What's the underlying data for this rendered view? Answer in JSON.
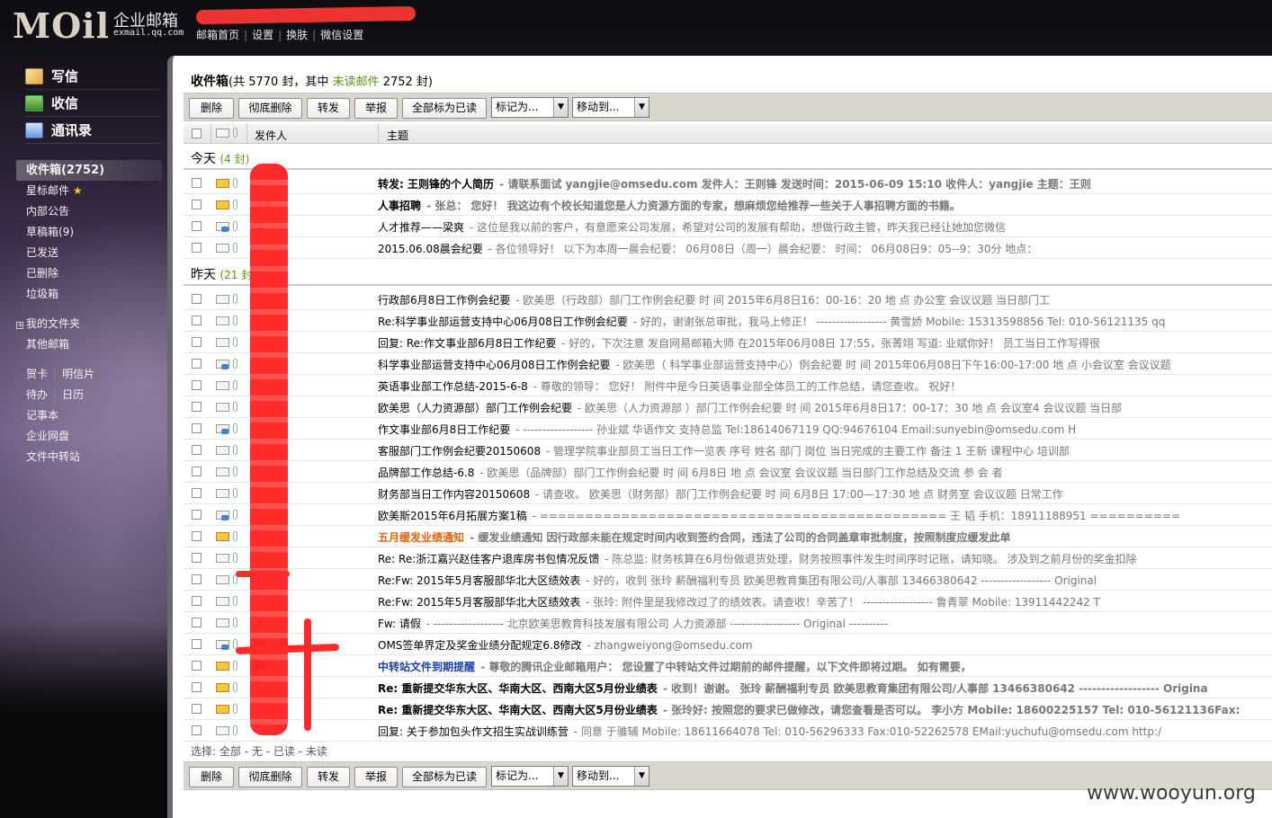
{
  "header": {
    "logo": "MOil",
    "product": "企业邮箱",
    "domain": "exmail.qq.com",
    "topnav": [
      "邮箱首页",
      "设置",
      "换肤",
      "微信设置"
    ]
  },
  "leftnav": {
    "big": [
      "写信",
      "收信",
      "通讯录"
    ],
    "folders": [
      "收件箱(2752)",
      "星标邮件",
      "内部公告",
      "草稿箱(9)",
      "已发送",
      "已删除",
      "垃圾箱"
    ],
    "star_icon": "★",
    "myfolders": "我的文件夹",
    "other": "其他邮箱",
    "tools": [
      [
        "贺卡",
        "明信片"
      ],
      [
        "待办",
        "日历"
      ]
    ],
    "tools2": [
      "记事本",
      "企业网盘",
      "文件中转站"
    ]
  },
  "folder": {
    "name": "收件箱",
    "total_pre": "(共 5770 封，其中",
    "unread_label": "未读邮件",
    "unread_post": "2752 封)"
  },
  "toolbar": {
    "delete": "删除",
    "perm_delete": "彻底删除",
    "forward": "转发",
    "report": "举报",
    "mark_all_read": "全部标为已读",
    "mark_as": "标记为...",
    "move_to": "移动到...",
    "arrow": "▼"
  },
  "columns": {
    "sender": "发件人",
    "subject": "主题"
  },
  "groups": {
    "today": {
      "label": "今天",
      "count": "(4 封)"
    },
    "yesterday": {
      "label": "昨天",
      "count": "(21 封)"
    }
  },
  "emails_today": [
    {
      "sender": "",
      "subject": "转发: 王则锋的个人简历",
      "snippet": " - 请联系面试 yangjie@omsedu.com 发件人：王则锋 发送时间：2015-06-09 15:10 收件人：yangjie 主题：王则",
      "style": "bold",
      "env": "unread"
    },
    {
      "sender": "y        a",
      "subject": "人事招聘",
      "snippet": " - 张总：  您好！  我这边有个校长知道您是人力资源方面的专家，想麻烦您给推荐一些关于人事招聘方面的书籍。",
      "style": "bold",
      "env": "unread"
    },
    {
      "sender": "李",
      "subject": "人才推荐——梁爽",
      "snippet": " - 这位是我以前的客户，有意愿来公司发展，希望对公司的发展有帮助，想做行政主管，昨天我已经让她加您微信",
      "style": "",
      "env": "replied"
    },
    {
      "sender": "",
      "subject": "2015.06.08晨会纪要",
      "snippet": " - 各位领导好！  以下为本周一晨会纪要：  06月08日（周一）晨会纪要：  时间：  06月08日9：05--9：30分 地点：",
      "style": "",
      "env": "read"
    }
  ],
  "emails_yesterday": [
    {
      "sender": "",
      "subject": "行政部6月8日工作例会纪要",
      "snippet": " - 欧美思（行政部）部门工作例会纪要 时 间 2015年6月8日16：00-16：20 地 点 办公室 会议议题 当日部门工",
      "style": "",
      "env": "read"
    },
    {
      "sender": "",
      "subject": "Re:科学事业部运营支持中心06月08日工作例会纪要",
      "snippet": " - 好的，谢谢张总审批，我马上修正！  ------------------ 黄雪娇 Mobile: 15313598856 Tel: 010-56121135 qq",
      "style": "",
      "env": "read"
    },
    {
      "sender": "",
      "subject": "回复: Re:作文事业部6月8日工作纪要",
      "snippet": " - 好的，下次注意 发自网易邮箱大师 在2015年06月08日 17:55，张菁翊 写道: 业斌你好！ 员工当日工作写得很",
      "style": "",
      "env": "read"
    },
    {
      "sender": "",
      "subject": "科学事业部运营支持中心06月08日工作例会纪要",
      "snippet": " - 欧美思（ 科学事业部运营支持中心）例会纪要 时 间 2015年06月08日下午16:00-17:00 地 点 小会议室 会议议题",
      "style": "",
      "env": "replied"
    },
    {
      "sender": "",
      "subject": "英语事业部工作总结-2015-6-8",
      "snippet": " - 尊敬的领导：  您好！  附件中是今日英语事业部全体员工的工作总结，请您查收。  祝好！",
      "style": "",
      "env": "read"
    },
    {
      "sender": "",
      "subject": "欧美思（人力资源部）部门工作例会纪要",
      "snippet": " - 欧美思（人力资源部 ）部门工作例会纪要 时 间 2015年6月8日17：00-17：30 地 点 会议室4 会议议题 当日部",
      "style": "",
      "env": "read"
    },
    {
      "sender": "",
      "subject": "作文事业部6月8日工作纪要",
      "snippet": " - ------------------ 孙业斌 华语作文 支持总监 Tel:18614067119 QQ:94676104 Email:sunyebin@omsedu.com H",
      "style": "",
      "env": "replied"
    },
    {
      "sender": "",
      "subject": "客服部门工作例会纪要20150608",
      "snippet": " - 管理学院事业部员工当日工作一览表 序号 姓名 部门 岗位 当日完成的主要工作 备注 1 王新 课程中心 培训部",
      "style": "",
      "env": "read"
    },
    {
      "sender": "",
      "subject": "品牌部工作总结-6.8",
      "snippet": " - 欧美思（品牌部）部门工作例会纪要 时 间 6月8日 地 点 会议室 会议议题 当日部门工作总结及交流 参 会 者",
      "style": "",
      "env": "read"
    },
    {
      "sender": "",
      "subject": "财务部当日工作内容20150608",
      "snippet": " - 请查收。 欧美思（财务部）部门工作例会纪要 时 间 6月8日 17:00—17:30 地 点 财务室 会议议题 日常工作",
      "style": "",
      "env": "read"
    },
    {
      "sender": "",
      "subject": "欧美斯2015年6月拓展方案1稿",
      "snippet": " - ============================================= 王 韬 手机：18911188951 ==========",
      "style": "",
      "env": "replied"
    },
    {
      "sender": "",
      "subject": "五月缓发业绩通知",
      "snippet": " - 缓发业绩通知 因行政部未能在规定时间内收到签约合同，违法了公司的合同盖章审批制度，按照制度应缓发此单",
      "style": "orange",
      "env": "unread"
    },
    {
      "sender": "",
      "subject": "Re: Re:浙江嘉兴赵佳客户退库房书包情况反馈",
      "snippet": " - 陈总监:  财务核算在6月份做退货处理，财务按照事件发生时间序时记账，请知晓。 涉及到之前月份的奖金扣除",
      "style": "",
      "env": "read"
    },
    {
      "sender": "",
      "subject": "Re:Fw: 2015年5月客服部华北大区绩效表",
      "snippet": " - 好的，收到 张玲 薪酬福利专员 欧美思教育集团有限公司/人事部 13466380642 ------------------ Original",
      "style": "",
      "env": "read"
    },
    {
      "sender": "",
      "subject": "Re:Fw: 2015年5月客服部华北大区绩效表",
      "snippet": " - 张玲:  附件里是我修改过了的绩效表。请查收！辛苦了！  ------------------ 鲁青翠 Mobile: 13911442242 T",
      "style": "",
      "env": "read"
    },
    {
      "sender": "人",
      "subject": "Fw: 请假",
      "snippet": " - ------------------ 北京欧美思教育科技发展有限公司 人力资源部 ------------------ Original ----------",
      "style": "",
      "env": "read"
    },
    {
      "sender": "zh             g@...",
      "subject": "OMS签单界定及奖金业绩分配规定6.8修改",
      "snippet": " -  zhangweiyong@omsedu.com",
      "style": "",
      "env": "replied"
    },
    {
      "sender": "腾",
      "subject": "中转站文件到期提醒",
      "snippet": " - 尊敬的腾讯企业邮箱用户：     您设置了中转站文件过期前的邮件提醒，以下文件即将过期。       如有需要，",
      "style": "blue",
      "env": "unread"
    },
    {
      "sender": "",
      "subject": "Re: 重新提交华东大区、华南大区、西南大区5月份业绩表",
      "snippet": " - 收到！谢谢。 张玲 薪酬福利专员 欧美思教育集团有限公司/人事部 13466380642 ------------------ Origina",
      "style": "bold",
      "env": "unread"
    },
    {
      "sender": "",
      "subject": "Re: 重新提交华东大区、华南大区、西南大区5月份业绩表",
      "snippet": " - 张玲好:  按照您的要求已做修改，请您查看是否可以。 李小方 Mobile: 18600225157 Tel: 010-56121136Fax:",
      "style": "bold",
      "env": "unread"
    },
    {
      "sender": "",
      "subject": "回复: 关于参加包头作文招生实战训练营",
      "snippet": " - 同意 于骓辅 Mobile: 18611664078 Tel: 010-56296333 Fax:010-52262578 EMail:yuchufu@omsedu.com http:/",
      "style": "",
      "env": "read"
    }
  ],
  "selectbar": {
    "label": "选择:",
    "all": "全部",
    "none": "无",
    "read": "已读",
    "unread": "未读"
  },
  "watermark": "www.wooyun.org"
}
